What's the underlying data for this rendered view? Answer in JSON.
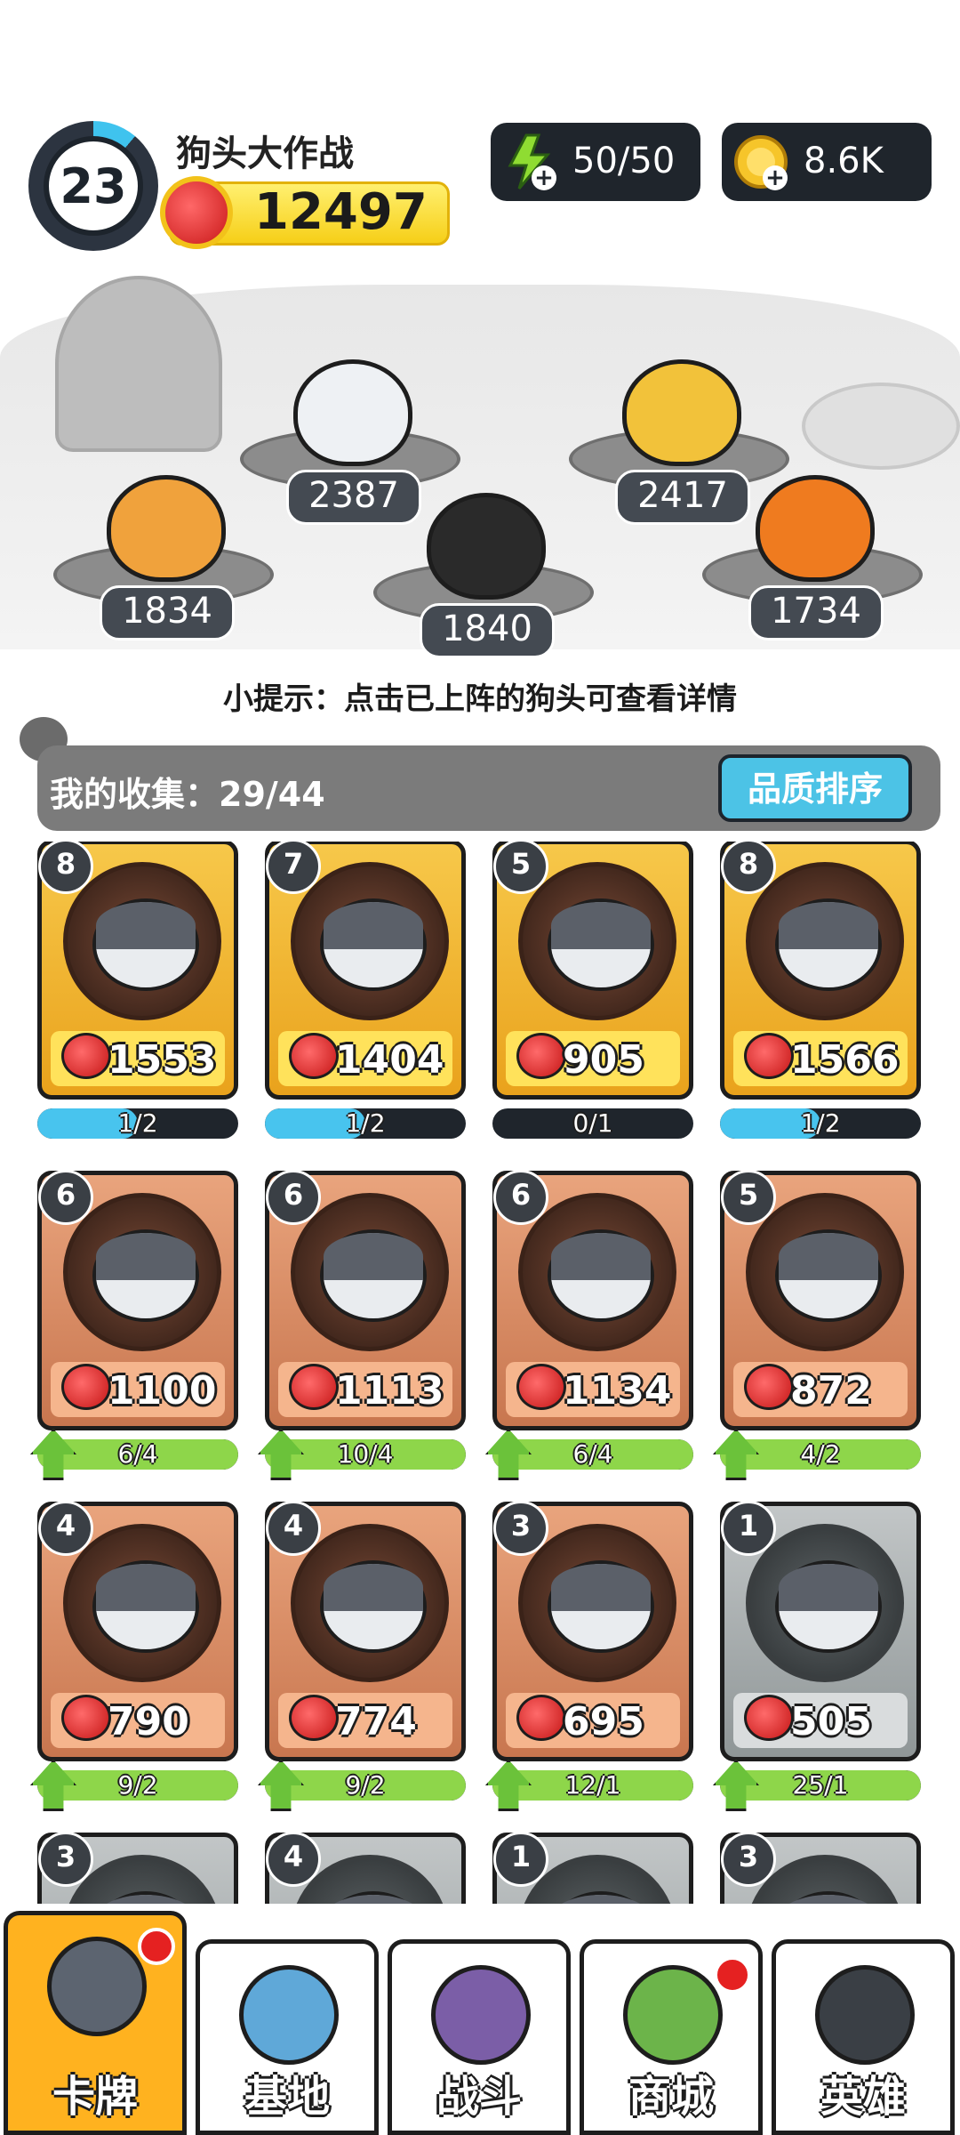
{
  "header": {
    "level": "23",
    "game_name": "狗头大作战",
    "total_power": "12497",
    "energy": "50/50",
    "coins": "8.6K",
    "colors": {
      "gold_bar": "#f6cf18",
      "pill_bg": "#1f252c"
    },
    "icons": {
      "energy": "lightning-icon",
      "coins": "coin-icon",
      "power": "fist-icon"
    }
  },
  "lineup": {
    "slots": [
      {
        "power": "2387",
        "pet": "dog-crown-sunglasses"
      },
      {
        "power": "2417",
        "pet": "dog-golden-helmet"
      },
      {
        "power": "1834",
        "pet": "dog-tiger-hood"
      },
      {
        "power": "1840",
        "pet": "dog-bomb"
      },
      {
        "power": "1734",
        "pet": "dog-pumpkin"
      }
    ]
  },
  "hint": "小提示：点击已上阵的狗头可查看详情",
  "collection": {
    "label": "我的收集：29/44",
    "sort_button": "品质排序"
  },
  "cards": [
    {
      "rank": "8",
      "power": "1553",
      "quality": "gold",
      "progress_text": "1/2",
      "progress": 0.5,
      "bar": "blue",
      "upgrade": false
    },
    {
      "rank": "7",
      "power": "1404",
      "quality": "gold",
      "progress_text": "1/2",
      "progress": 0.5,
      "bar": "blue",
      "upgrade": false
    },
    {
      "rank": "5",
      "power": "905",
      "quality": "gold",
      "progress_text": "0/1",
      "progress": 0,
      "bar": "blue",
      "upgrade": false
    },
    {
      "rank": "8",
      "power": "1566",
      "quality": "gold",
      "progress_text": "1/2",
      "progress": 0.5,
      "bar": "blue",
      "upgrade": false
    },
    {
      "rank": "6",
      "power": "1100",
      "quality": "bronze",
      "progress_text": "6/4",
      "progress": 1,
      "bar": "green",
      "upgrade": true
    },
    {
      "rank": "6",
      "power": "1113",
      "quality": "bronze",
      "progress_text": "10/4",
      "progress": 1,
      "bar": "green",
      "upgrade": true
    },
    {
      "rank": "6",
      "power": "1134",
      "quality": "bronze",
      "progress_text": "6/4",
      "progress": 1,
      "bar": "green",
      "upgrade": true
    },
    {
      "rank": "5",
      "power": "872",
      "quality": "bronze",
      "progress_text": "4/2",
      "progress": 1,
      "bar": "green",
      "upgrade": true
    },
    {
      "rank": "4",
      "power": "790",
      "quality": "bronze",
      "progress_text": "9/2",
      "progress": 1,
      "bar": "green",
      "upgrade": true
    },
    {
      "rank": "4",
      "power": "774",
      "quality": "bronze",
      "progress_text": "9/2",
      "progress": 1,
      "bar": "green",
      "upgrade": true
    },
    {
      "rank": "3",
      "power": "695",
      "quality": "bronze",
      "progress_text": "12/1",
      "progress": 1,
      "bar": "green",
      "upgrade": true
    },
    {
      "rank": "1",
      "power": "505",
      "quality": "silver",
      "progress_text": "25/1",
      "progress": 1,
      "bar": "green",
      "upgrade": true
    },
    {
      "rank": "3",
      "power": "",
      "quality": "silver",
      "progress_text": "",
      "progress": 0,
      "bar": "green",
      "upgrade": false
    },
    {
      "rank": "4",
      "power": "",
      "quality": "silver",
      "progress_text": "",
      "progress": 0,
      "bar": "green",
      "upgrade": false
    },
    {
      "rank": "1",
      "power": "",
      "quality": "silver",
      "progress_text": "",
      "progress": 0,
      "bar": "green",
      "upgrade": false
    },
    {
      "rank": "3",
      "power": "",
      "quality": "silver",
      "progress_text": "",
      "progress": 0,
      "bar": "green",
      "upgrade": false
    }
  ],
  "tabs": [
    {
      "label": "卡牌",
      "icon": "dog-face-icon",
      "active": true,
      "badge": true,
      "color": "#ffb21f"
    },
    {
      "label": "基地",
      "icon": "castle-icon",
      "active": false,
      "badge": false,
      "color": "#ffffff"
    },
    {
      "label": "战斗",
      "icon": "paw-icon",
      "active": false,
      "badge": false,
      "color": "#ffffff"
    },
    {
      "label": "商城",
      "icon": "cash-icon",
      "active": false,
      "badge": true,
      "color": "#ffffff"
    },
    {
      "label": "英雄",
      "icon": "top-hat-dog-icon",
      "active": false,
      "badge": false,
      "color": "#ffffff"
    }
  ]
}
